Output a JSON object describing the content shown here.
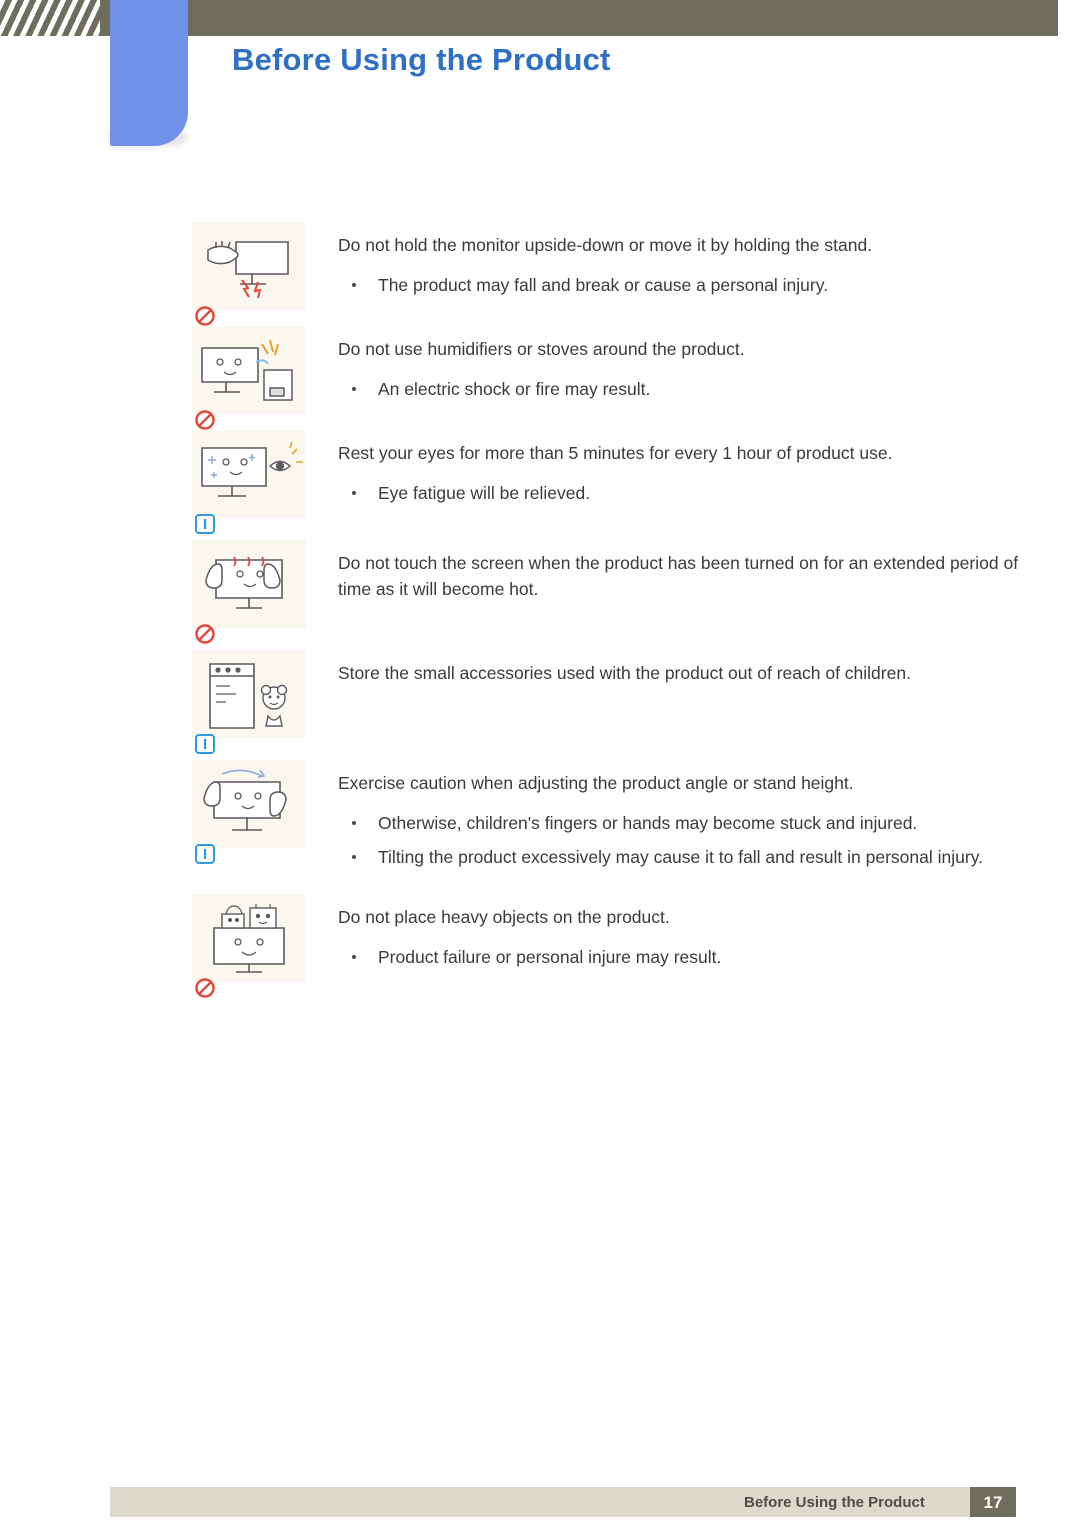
{
  "header": {
    "title": "Before Using the Product"
  },
  "footer": {
    "chapter": "Before Using the Product",
    "page": "17"
  },
  "colors": {
    "header_bar": "#6f6d5d",
    "tab_blue": "#6f91e8",
    "heading_blue": "#2f6fc4",
    "icon_panel": "#faf7ef",
    "footer_bar": "#ded9cd",
    "prohibition_red": "#e8443a",
    "info_blue": "#2f9ad8"
  },
  "items": [
    {
      "icon": "monitor-upside-down-icon",
      "badge": "prohibition-badge",
      "lines": [
        {
          "type": "main",
          "text": "Do not hold the monitor upside-down or move it by holding the stand."
        },
        {
          "type": "bullet",
          "text": "The product may fall and break or cause a personal injury."
        }
      ]
    },
    {
      "icon": "humidifier-stove-icon",
      "badge": "prohibition-badge",
      "lines": [
        {
          "type": "main",
          "text": "Do not use humidifiers or stoves around the product."
        },
        {
          "type": "bullet",
          "text": "An electric shock or fire may result."
        }
      ]
    },
    {
      "icon": "rest-eyes-icon",
      "badge": "info-badge",
      "lines": [
        {
          "type": "main",
          "text": "Rest your eyes for more than 5 minutes for every 1 hour of product use."
        },
        {
          "type": "bullet",
          "text": "Eye fatigue will be relieved."
        }
      ]
    },
    {
      "icon": "hot-screen-touch-icon",
      "badge": "prohibition-badge",
      "lines": [
        {
          "type": "main",
          "text": "Do not touch the screen when the product has been turned on for an extended period of time as it will become hot."
        }
      ]
    },
    {
      "icon": "small-accessories-child-icon",
      "badge": "info-badge",
      "lines": [
        {
          "type": "main",
          "text": "Store the small accessories used with the product out of reach of children."
        }
      ]
    },
    {
      "icon": "adjust-angle-icon",
      "badge": "info-badge",
      "lines": [
        {
          "type": "main",
          "text": "Exercise caution when adjusting the product angle or stand height."
        },
        {
          "type": "bullet",
          "text": "Otherwise, children's fingers or hands may become stuck and injured."
        },
        {
          "type": "bullet",
          "text": "Tilting the product excessively may cause it to fall and result in personal injury."
        }
      ]
    },
    {
      "icon": "heavy-objects-icon",
      "badge": "prohibition-badge",
      "lines": [
        {
          "type": "main",
          "text": "Do not place heavy objects on the product."
        },
        {
          "type": "bullet",
          "text": "Product failure or personal injure may result."
        }
      ]
    }
  ]
}
